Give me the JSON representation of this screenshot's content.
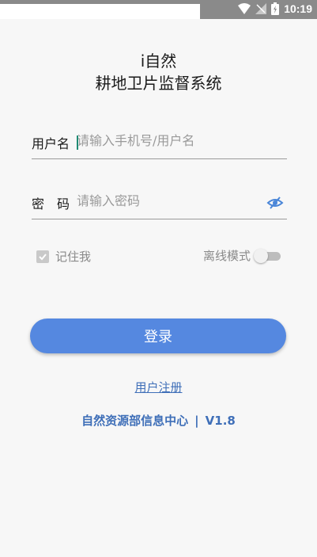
{
  "status_bar": {
    "time": "10:19",
    "icons": [
      "wifi-icon",
      "signal-icon",
      "battery-icon"
    ]
  },
  "header": {
    "app_name": "i自然",
    "subtitle": "耕地卫片监督系统"
  },
  "form": {
    "username": {
      "label": "用户名",
      "placeholder": "请输入手机号/用户名",
      "value": ""
    },
    "password": {
      "label": "密　码",
      "placeholder": "请输入密码",
      "value": "",
      "visibility_icon": "eye-off-icon"
    },
    "remember": {
      "label": "记住我",
      "checked": true
    },
    "offline_mode": {
      "label": "离线模式",
      "enabled": false
    },
    "login_label": "登录"
  },
  "register_label": "用户注册",
  "footer": {
    "org": "自然资源部信息中心",
    "separator": "|",
    "version": "V1.8"
  },
  "colors": {
    "accent": "#5588e0",
    "link": "#3f6fb8",
    "background": "#f7f7f7"
  }
}
